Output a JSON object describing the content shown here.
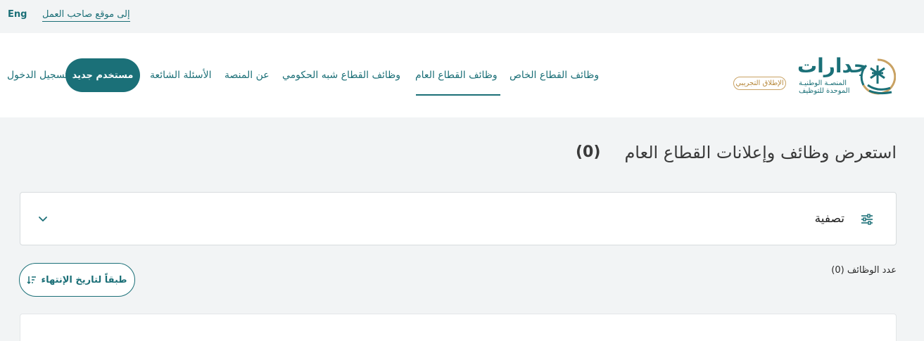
{
  "topbar": {
    "lang_label": "Eng",
    "employer_link": "إلى موقع صاحب العمل"
  },
  "header": {
    "login_label": "تسجيل الدخول",
    "new_user_label": "مستخدم جديد",
    "nav": {
      "faq": "الأسئلة الشائعة",
      "about": "عن المنصة",
      "semi_gov": "وظائف القطاع شبه الحكومي",
      "public": "وظائف القطاع العام",
      "private": "وظائف القطاع الخاص"
    },
    "logo": {
      "badge": "الإطلاق التجريبي",
      "word": "جدارات",
      "sub1": "المنصـة الوطنيـة",
      "sub2": "الموحدة للتوظيف"
    }
  },
  "main": {
    "title": "استعرض وظائف وإعلانات القطاع العام",
    "title_count": "(0)",
    "filter_label": "تصفية",
    "job_count": "عدد الوظائف (0)",
    "sort_label": "طبقاً لتاريخ الإنتهاء"
  },
  "colors": {
    "primary": "#1b7078",
    "gold": "#c9a263",
    "page_bg": "#f2f4f5"
  },
  "icons": {
    "filter": "sliders-icon",
    "chevron": "chevron-down-icon",
    "sort": "sort-descending-icon",
    "emblem": "palm-swords-emblem-icon"
  }
}
